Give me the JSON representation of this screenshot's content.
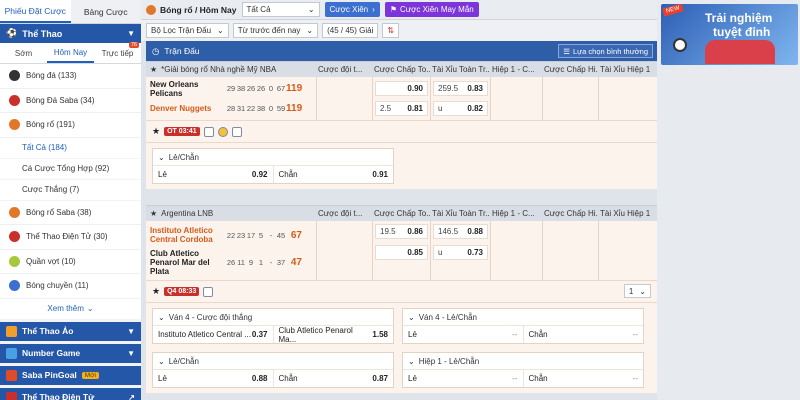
{
  "sidebar": {
    "tabs": [
      "Phiếu Đặt Cược",
      "Bảng Cược"
    ],
    "section_title": "Thể Thao",
    "sub_tabs": [
      {
        "label": "Sớm"
      },
      {
        "label": "Hôm Nay"
      },
      {
        "label": "Trực tiếp",
        "badge": "76"
      }
    ],
    "sports": [
      {
        "label": "Bóng đá (133)",
        "color": "#333333"
      },
      {
        "label": "Bóng Đá Saba (34)",
        "color": "#c9302c"
      },
      {
        "label": "Bóng rổ (191)",
        "color": "#e2772a"
      }
    ],
    "basketball_sub": [
      "Tất Cả (184)",
      "Cá Cược Tổng Hợp (92)",
      "Cược Thắng (7)"
    ],
    "sports2": [
      {
        "label": "Bóng rổ Saba (38)",
        "color": "#e2772a"
      },
      {
        "label": "Thể Thao Điện Tử (30)",
        "color": "#c9302c"
      },
      {
        "label": "Quần vợt (10)",
        "color": "#a6c93a"
      },
      {
        "label": "Bóng chuyền (11)",
        "color": "#3c6fd0"
      }
    ],
    "see_more": "Xem thêm",
    "categories": [
      {
        "label": "Thể Thao Ảo"
      },
      {
        "label": "Number Game"
      },
      {
        "label": "Saba PinGoal",
        "badge": "Mới"
      },
      {
        "label": "Thể Thao Điện Tử"
      }
    ]
  },
  "topbar": {
    "title": "Bóng rổ / Hôm Nay",
    "select_value": "Tất Cả",
    "combo_button": "Cược Xiên",
    "lucky_button": "Cược Xiên May Mắn"
  },
  "filters": {
    "league_filter": "Bộ Lọc Trận Đấu",
    "time_sort": "Từ trước đến nay",
    "count": "(45 / 45) Giải"
  },
  "section": {
    "title": "Trận Đấu",
    "sort_label": "Lựa chọn bình thường"
  },
  "leagues": [
    {
      "name": "*Giải bóng rổ Nhà nghề Mỹ NBA",
      "cols": [
        "Cược đội t...",
        "Cược Chấp To...",
        "Tài Xỉu Toàn Tr...",
        "Hiệp 1 - C...",
        "Cược Chấp Hi...",
        "Tài Xỉu Hiệp 1"
      ],
      "teams": [
        {
          "name": "New Orleans Pelicans",
          "scores": [
            "29",
            "38",
            "26",
            "26",
            "0",
            "67"
          ],
          "total": "119"
        },
        {
          "name": "Denver Nuggets",
          "scores": [
            "28",
            "31",
            "22",
            "38",
            "0",
            "59"
          ],
          "total": "119"
        }
      ],
      "handicap": [
        {
          "h": "",
          "v": "0.90"
        },
        {
          "h": "2.5",
          "v": "0.81"
        }
      ],
      "ou": [
        {
          "h": "259.5",
          "v": "0.83"
        },
        {
          "h": "u",
          "v": "0.82"
        }
      ],
      "live": "OT 03:41",
      "oddeven_title": "Lẻ/Chẵn",
      "odd_label": "Lẻ",
      "odd_value": "0.92",
      "even_label": "Chẵn",
      "even_value": "0.91"
    },
    {
      "name": "Argentina LNB",
      "cols": [
        "Cược đội t...",
        "Cược Chấp To...",
        "Tài Xỉu Toàn Tr...",
        "Hiệp 1 - C...",
        "Cược Chấp Hi...",
        "Tài Xỉu Hiệp 1"
      ],
      "teams": [
        {
          "name": "Instituto Atletico Central Cordoba",
          "scores": [
            "22",
            "23",
            "17",
            "5",
            "-",
            "45"
          ],
          "total": "67"
        },
        {
          "name": "Club Atletico Penarol Mar del Plata",
          "scores": [
            "26",
            "11",
            "9",
            "1",
            "-",
            "37"
          ],
          "total": "47"
        }
      ],
      "handicap": [
        {
          "h": "19.5",
          "v": "0.86"
        },
        {
          "h": "",
          "v": "0.85"
        }
      ],
      "ou": [
        {
          "h": "146.5",
          "v": "0.88"
        },
        {
          "h": "u",
          "v": "0.73"
        }
      ],
      "live": "Q4 08:33",
      "page": "1",
      "panels": [
        {
          "title": "Ván 4 - Cược đội thắng",
          "a_label": "Instituto Atletico Central ...",
          "a_value": "0.37",
          "b_label": "Club Atletico Penarol Ma...",
          "b_value": "1.58"
        },
        {
          "title": "Ván 4 - Lẻ/Chẵn",
          "a_label": "Lẻ",
          "a_value": "--",
          "b_label": "Chẵn",
          "b_value": "--"
        },
        {
          "title": "Lẻ/Chẵn",
          "a_label": "Lẻ",
          "a_value": "0.88",
          "b_label": "Chẵn",
          "b_value": "0.87"
        },
        {
          "title": "Hiệp 1 - Lẻ/Chẵn",
          "a_label": "Lẻ",
          "a_value": "--",
          "b_label": "Chẵn",
          "b_value": "--"
        }
      ]
    }
  ],
  "banner": {
    "tag": "NEW",
    "line1": "Trải nghiệm",
    "line2": "tuyệt đỉnh"
  }
}
